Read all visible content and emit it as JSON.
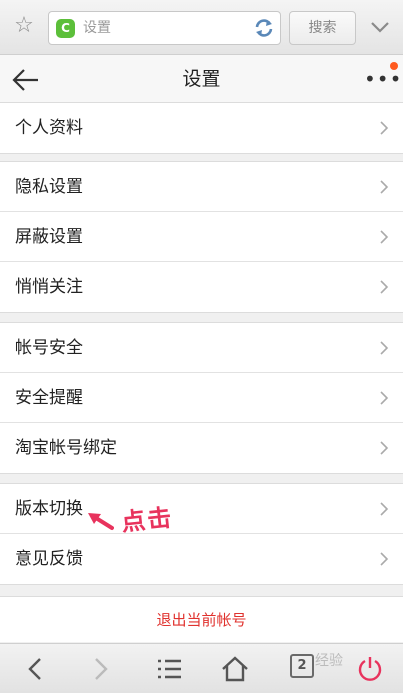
{
  "browser": {
    "address_text": "设置",
    "site_badge": "C",
    "search_label": "搜索"
  },
  "header": {
    "title": "设置"
  },
  "groups": [
    {
      "items": [
        "个人资料"
      ]
    },
    {
      "items": [
        "隐私设置",
        "屏蔽设置",
        "悄悄关注"
      ]
    },
    {
      "items": [
        "帐号安全",
        "安全提醒",
        "淘宝帐号绑定"
      ]
    },
    {
      "items": [
        "版本切换",
        "意见反馈"
      ]
    }
  ],
  "logout_label": "退出当前帐号",
  "annotation": {
    "text": "点击",
    "color": "#e8335d"
  },
  "toolbar": {
    "tabs_count": "2",
    "watermark": "经验"
  },
  "colors": {
    "accent_red": "#e0322e",
    "badge_green": "#5cbf3a",
    "notify_dot": "#ff5a1f"
  }
}
